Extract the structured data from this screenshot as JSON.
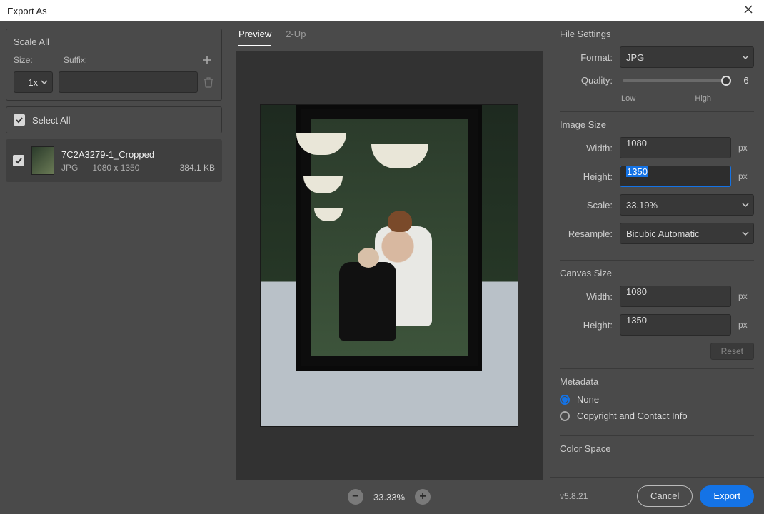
{
  "title": "Export As",
  "left": {
    "scale_all": "Scale All",
    "size_label": "Size:",
    "suffix_label": "Suffix:",
    "size_value": "1x",
    "suffix_value": "",
    "select_all": "Select All",
    "asset": {
      "name": "7C2A3279-1_Cropped",
      "format": "JPG",
      "dimensions": "1080 x 1350",
      "filesize": "384.1 KB"
    }
  },
  "tabs": {
    "preview": "Preview",
    "twoup": "2-Up"
  },
  "zoom": "33.33%",
  "settings": {
    "file_settings": "File Settings",
    "format_label": "Format:",
    "format_value": "JPG",
    "quality_label": "Quality:",
    "quality_value": "6",
    "quality_low": "Low",
    "quality_high": "High",
    "image_size": "Image Size",
    "width_label": "Width:",
    "height_label": "Height:",
    "img_width": "1080",
    "img_height": "1350",
    "px": "px",
    "scale_label": "Scale:",
    "scale_value": "33.19%",
    "resample_label": "Resample:",
    "resample_value": "Bicubic Automatic",
    "canvas_size": "Canvas Size",
    "canvas_width": "1080",
    "canvas_height": "1350",
    "reset": "Reset",
    "metadata": "Metadata",
    "meta_none": "None",
    "meta_copyright": "Copyright and Contact Info",
    "color_space": "Color Space"
  },
  "footer": {
    "version": "v5.8.21",
    "cancel": "Cancel",
    "export": "Export"
  }
}
